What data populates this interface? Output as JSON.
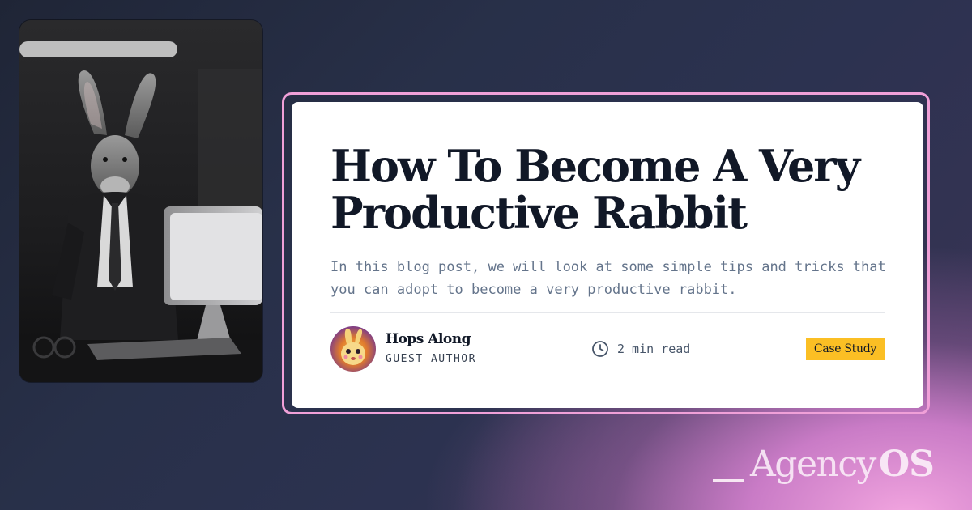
{
  "post": {
    "title": "How To Become A Very Productive Rabbit",
    "summary": "In this blog post, we will look at some simple tips and tricks that you can adopt to become a very productive rabbit.",
    "author": {
      "name": "Hops Along",
      "role": "GUEST AUTHOR"
    },
    "read_time": "2 min read",
    "category": "Case Study"
  },
  "brand": {
    "logo_light": "Agency",
    "logo_bold": "OS"
  },
  "icons": {
    "read_time": "clock-icon"
  },
  "colors": {
    "frame": "#f0a0d8",
    "badge": "#fbbf24",
    "title": "#111827",
    "summary": "#64748b"
  }
}
